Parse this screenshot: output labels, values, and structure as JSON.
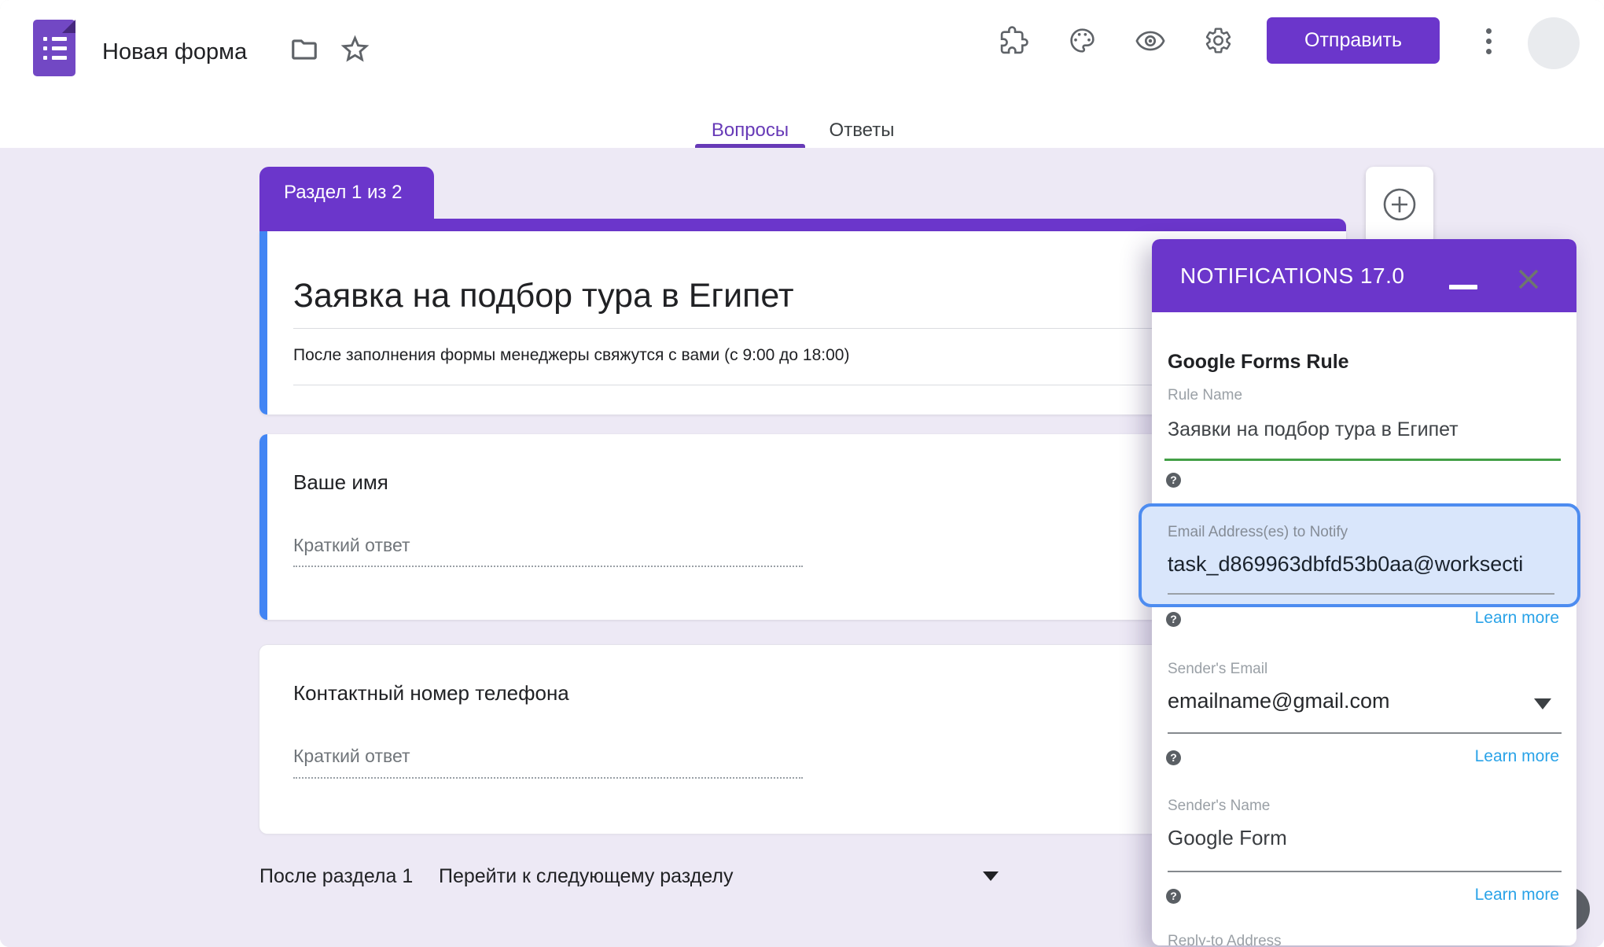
{
  "header": {
    "app_title": "Новая форма",
    "send_button": "Отправить"
  },
  "tabs": {
    "questions": "Вопросы",
    "answers": "Ответы"
  },
  "section": {
    "tab_label": "Раздел 1 из 2",
    "after_section_label": "После раздела 1",
    "after_section_action": "Перейти к следующему разделу"
  },
  "form": {
    "title": "Заявка на подбор тура в Египет",
    "description": "После заполнения формы менеджеры свяжутся с вами (с 9:00 до 18:00)",
    "questions": [
      {
        "title": "Ваше имя",
        "placeholder": "Краткий ответ"
      },
      {
        "title": "Контактный номер телефона",
        "placeholder": "Краткий ответ"
      }
    ]
  },
  "addon_panel": {
    "title": "NOTIFICATIONS 17.0",
    "heading": "Google Forms Rule",
    "rule_name": {
      "label": "Rule Name",
      "value": "Заявки на подбор тура в Египет"
    },
    "notify_email": {
      "label": "Email Address(es) to Notify",
      "value": "task_d869963dbfd53b0aa@worksecti"
    },
    "sender_email": {
      "label": "Sender's Email",
      "value": "emailname@gmail.com"
    },
    "sender_name": {
      "label": "Sender's Name",
      "value": "Google Form"
    },
    "reply_to": {
      "label": "Reply-to Address"
    },
    "learn_more": "Learn more",
    "help_glyph": "?"
  },
  "colors": {
    "accent_purple": "#6b36cb",
    "tab_active_purple": "#673ab7",
    "card_accent_blue": "#4285f4",
    "highlight_border": "#4d8cf0",
    "highlight_fill": "#d9e6fb",
    "valid_green": "#43a047",
    "link_blue": "#2aa3e8",
    "canvas_background": "#ede9f5"
  }
}
